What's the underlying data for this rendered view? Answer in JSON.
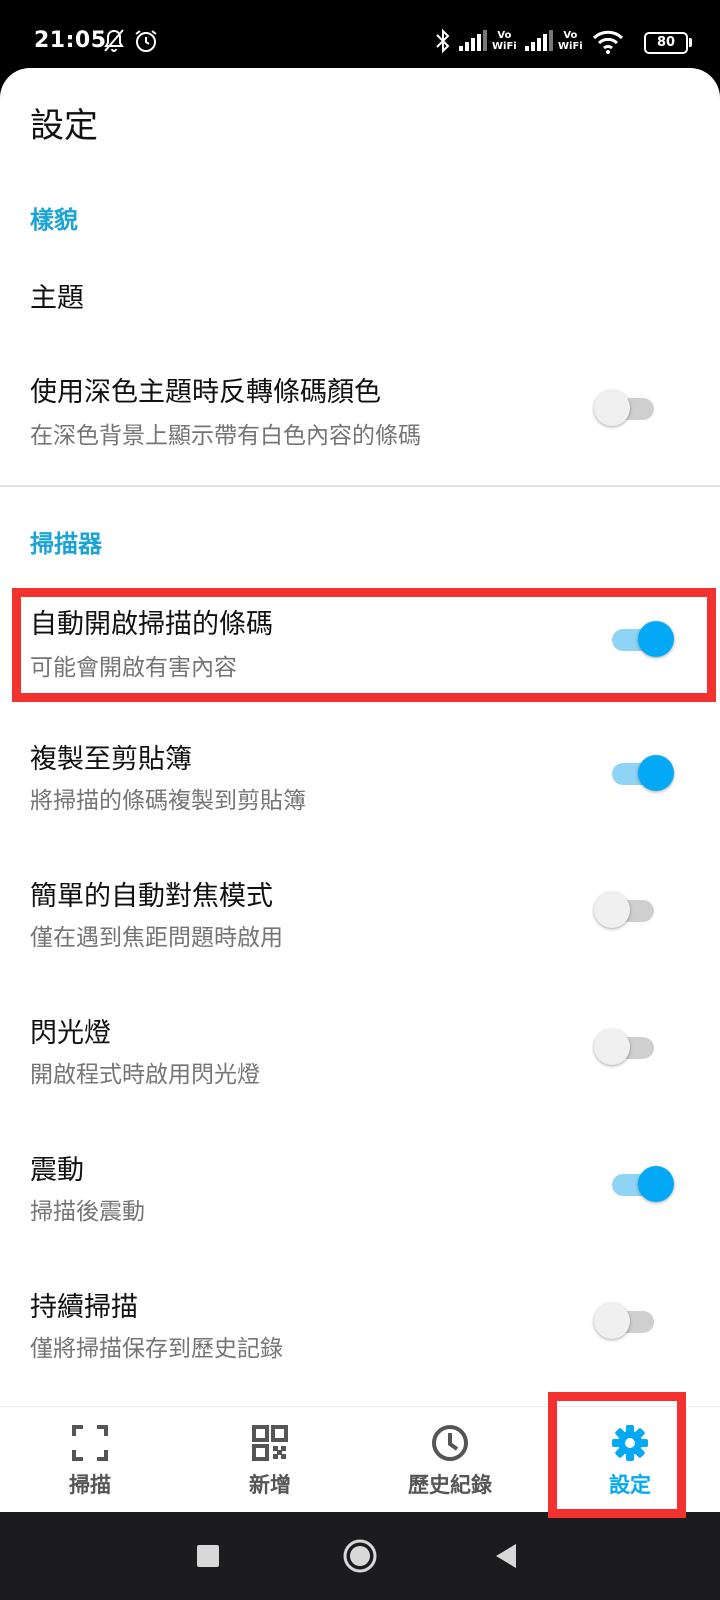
{
  "status_bar": {
    "time": "21:05",
    "vowifi_1": "Vo\nWiFi",
    "vowifi_2": "Vo\nWiFi",
    "battery": "80"
  },
  "page": {
    "title": "設定"
  },
  "sections": {
    "appearance": {
      "header": "樣貌"
    },
    "scanner": {
      "header": "掃描器"
    }
  },
  "settings": {
    "theme": {
      "title": "主題"
    },
    "invert_dark": {
      "title": "使用深色主題時反轉條碼顏色",
      "subtitle": "在深色背景上顯示帶有白色內容的條碼",
      "enabled": false
    },
    "auto_open": {
      "title": "自動開啟掃描的條碼",
      "subtitle": "可能會開啟有害內容",
      "enabled": true
    },
    "copy_clipboard": {
      "title": "複製至剪貼簿",
      "subtitle": "將掃描的條碼複製到剪貼簿",
      "enabled": true
    },
    "simple_autofocus": {
      "title": "簡單的自動對焦模式",
      "subtitle": "僅在遇到焦距問題時啟用",
      "enabled": false
    },
    "flashlight": {
      "title": "閃光燈",
      "subtitle": "開啟程式時啟用閃光燈",
      "enabled": false
    },
    "vibrate": {
      "title": "震動",
      "subtitle": "掃描後震動",
      "enabled": true
    },
    "continuous_scan": {
      "title": "持續掃描",
      "subtitle": "僅將掃描保存到歷史記錄",
      "enabled": false
    }
  },
  "bottom_nav": {
    "scan": "掃描",
    "create": "新增",
    "history": "歷史紀錄",
    "settings": "設定",
    "active": "settings"
  },
  "colors": {
    "accent": "#03a9f4",
    "section_header": "#1ba3d6",
    "annotation_red": "#f3312f"
  }
}
